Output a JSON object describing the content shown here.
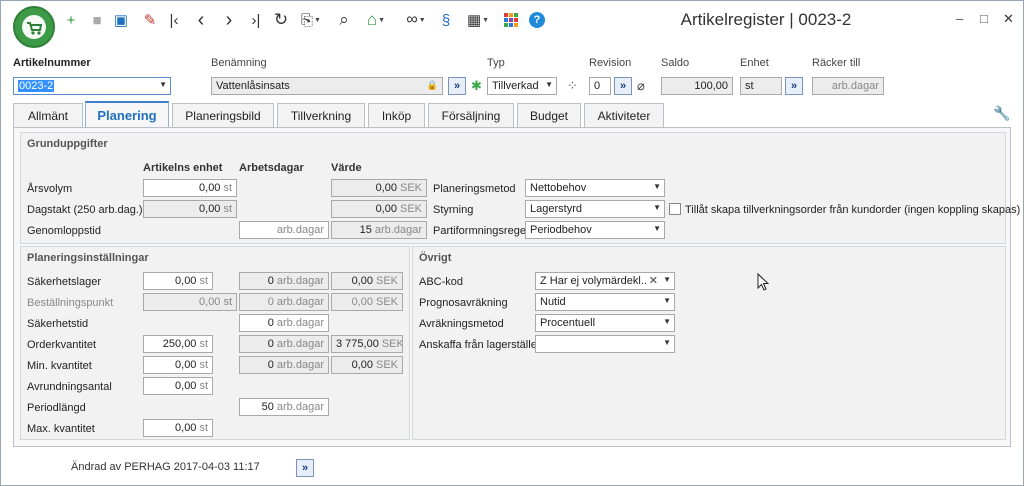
{
  "window": {
    "title": "Artikelregister | 0023-2",
    "min": "–",
    "max": "□",
    "close": "✕"
  },
  "toolbar": {
    "new": "+",
    "save": "■",
    "save_as": "▣",
    "delete": "✎",
    "first": "|‹",
    "prev": "‹",
    "next": "›",
    "last": "›|",
    "refresh": "↻",
    "clipboard": "⎘",
    "search": "⌕",
    "home": "⌂",
    "link": "∞",
    "fingerprint": "§",
    "layout": "▦",
    "apps": "▩",
    "help": "?"
  },
  "header": {
    "artikelnummer_label": "Artikelnummer",
    "artikelnummer_value": "0023-2",
    "benamning_label": "Benämning",
    "benamning_value": "Vattenlåsinsats",
    "typ_label": "Typ",
    "typ_value": "Tillverkad",
    "revision_label": "Revision",
    "revision_value": "0",
    "saldo_label": "Saldo",
    "saldo_value": "100,00",
    "enhet_label": "Enhet",
    "enhet_value": "st",
    "racker_label": "Räcker till",
    "racker_value": "arb.dagar"
  },
  "tabs": [
    "Allmänt",
    "Planering",
    "Planeringsbild",
    "Tillverkning",
    "Inköp",
    "Försäljning",
    "Budget",
    "Aktiviteter"
  ],
  "grund": {
    "title": "Grunduppgifter",
    "col_enhet": "Artikelns enhet",
    "col_dagar": "Arbetsdagar",
    "col_varde": "Värde",
    "arsvolym_label": "Årsvolym",
    "arsvolym_value": "0,00",
    "arsvolym_unit": "st",
    "arsvolym_varde": "0,00",
    "arsvolym_varde_unit": "SEK",
    "dagstakt_label": "Dagstakt (250 arb.dag.)",
    "dagstakt_value": "0,00",
    "dagstakt_unit": "st",
    "dagstakt_varde": "0,00",
    "dagstakt_varde_unit": "SEK",
    "genomlopp_label": "Genomloppstid",
    "genomlopp_dagar_unit": "arb.dagar",
    "genomlopp_varde": "15",
    "genomlopp_varde_unit": "arb.dagar",
    "planeringsmetod_label": "Planeringsmetod",
    "planeringsmetod_value": "Nettobehov",
    "styrning_label": "Styrning",
    "styrning_value": "Lagerstyrd",
    "partiform_label": "Partiformningsregel",
    "partiform_value": "Periodbehov",
    "checkbox_label": "Tillåt skapa tillverkningsorder från kundorder (ingen koppling skapas)"
  },
  "plan": {
    "title": "Planeringsinställningar",
    "unit_st": "st",
    "unit_dagar": "arb.dagar",
    "unit_sek": "SEK",
    "sakerhetslager_label": "Säkerhetslager",
    "sakerhetslager_value": "0,00",
    "sakerhetslager_dagar": "0",
    "sakerhetslager_varde": "0,00",
    "bestpunkt_label": "Beställningspunkt",
    "bestpunkt_value": "0,00",
    "bestpunkt_dagar": "0",
    "bestpunkt_varde": "0,00",
    "sakerhetstid_label": "Säkerhetstid",
    "sakerhetstid_dagar": "0",
    "orderkvantitet_label": "Orderkvantitet",
    "orderkvantitet_value": "250,00",
    "orderkvantitet_dagar": "0",
    "orderkvantitet_varde": "3 775,00",
    "minkvant_label": "Min. kvantitet",
    "minkvant_value": "0,00",
    "minkvant_dagar": "0",
    "minkvant_varde": "0,00",
    "avrundning_label": "Avrundningsantal",
    "avrundning_value": "0,00",
    "periodlangd_label": "Periodlängd",
    "periodlangd_dagar": "50",
    "maxkvant_label": "Max. kvantitet",
    "maxkvant_value": "0,00"
  },
  "ovrigt": {
    "title": "Övrigt",
    "abc_label": "ABC-kod",
    "abc_value": "Z Har ej volymärdekl...",
    "prognos_label": "Prognosavräkning",
    "prognos_value": "Nutid",
    "avrakning_label": "Avräkningsmetod",
    "avrakning_value": "Procentuell",
    "anskaffa_label": "Anskaffa från lagerställe",
    "anskaffa_value": ""
  },
  "footer": {
    "changed": "Ändrad av PERHAG 2017-04-03 11:17"
  }
}
